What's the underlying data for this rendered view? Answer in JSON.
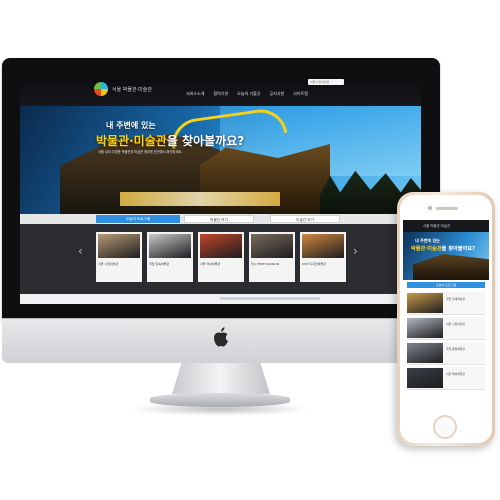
{
  "site": {
    "logo_text": "서울 박물관·미술관",
    "search_placeholder": "서울시립미술관",
    "nav": [
      "서비스소개",
      "협력기관",
      "오늘의 가볼곳",
      "공지사항",
      "사이트맵"
    ],
    "hero": {
      "subtitle": "내 주변에 있는",
      "title_main": "박물관·미술관",
      "title_rest": "을 찾아볼까요?",
      "description": "서울 내의 다양한 박물관과 미술관 정보를 한곳에서 확인하세요."
    },
    "tabs": [
      "오늘의 프로그램",
      "박물관 보기",
      "미술관 보기"
    ],
    "cards": [
      {
        "caption": "서울 시립미술관",
        "color": "#b79a74"
      },
      {
        "caption": "국립 민속박물관",
        "color": "#c8c8c8"
      },
      {
        "caption": "서울 역사박물관",
        "color": "#c2452b"
      },
      {
        "caption": "전시 FREE PASSION",
        "color": "#7a6a5c"
      },
      {
        "caption": "DDP 디자인박물관",
        "color": "#d0873e"
      }
    ]
  },
  "phone": {
    "logo_text": "서울 박물관·미술관",
    "hero": {
      "subtitle": "내 주변에 있는",
      "title_main": "박물관·미술관",
      "title_rest": "을 찾아볼까요?"
    },
    "tab": "오늘의 프로그램",
    "cards": [
      {
        "caption": "국립 현대미술관",
        "color": "#c99a4a"
      },
      {
        "caption": "서울 시립미술관",
        "color": "#b2b7c1"
      },
      {
        "caption": "국립 중앙박물관",
        "color": "#7e8590"
      },
      {
        "caption": "서울 역사박물관",
        "color": "#3b3f47"
      }
    ]
  },
  "colors": {
    "accent": "#2f8fe0",
    "highlight": "#ffd11a",
    "header": "#0c0c10"
  }
}
